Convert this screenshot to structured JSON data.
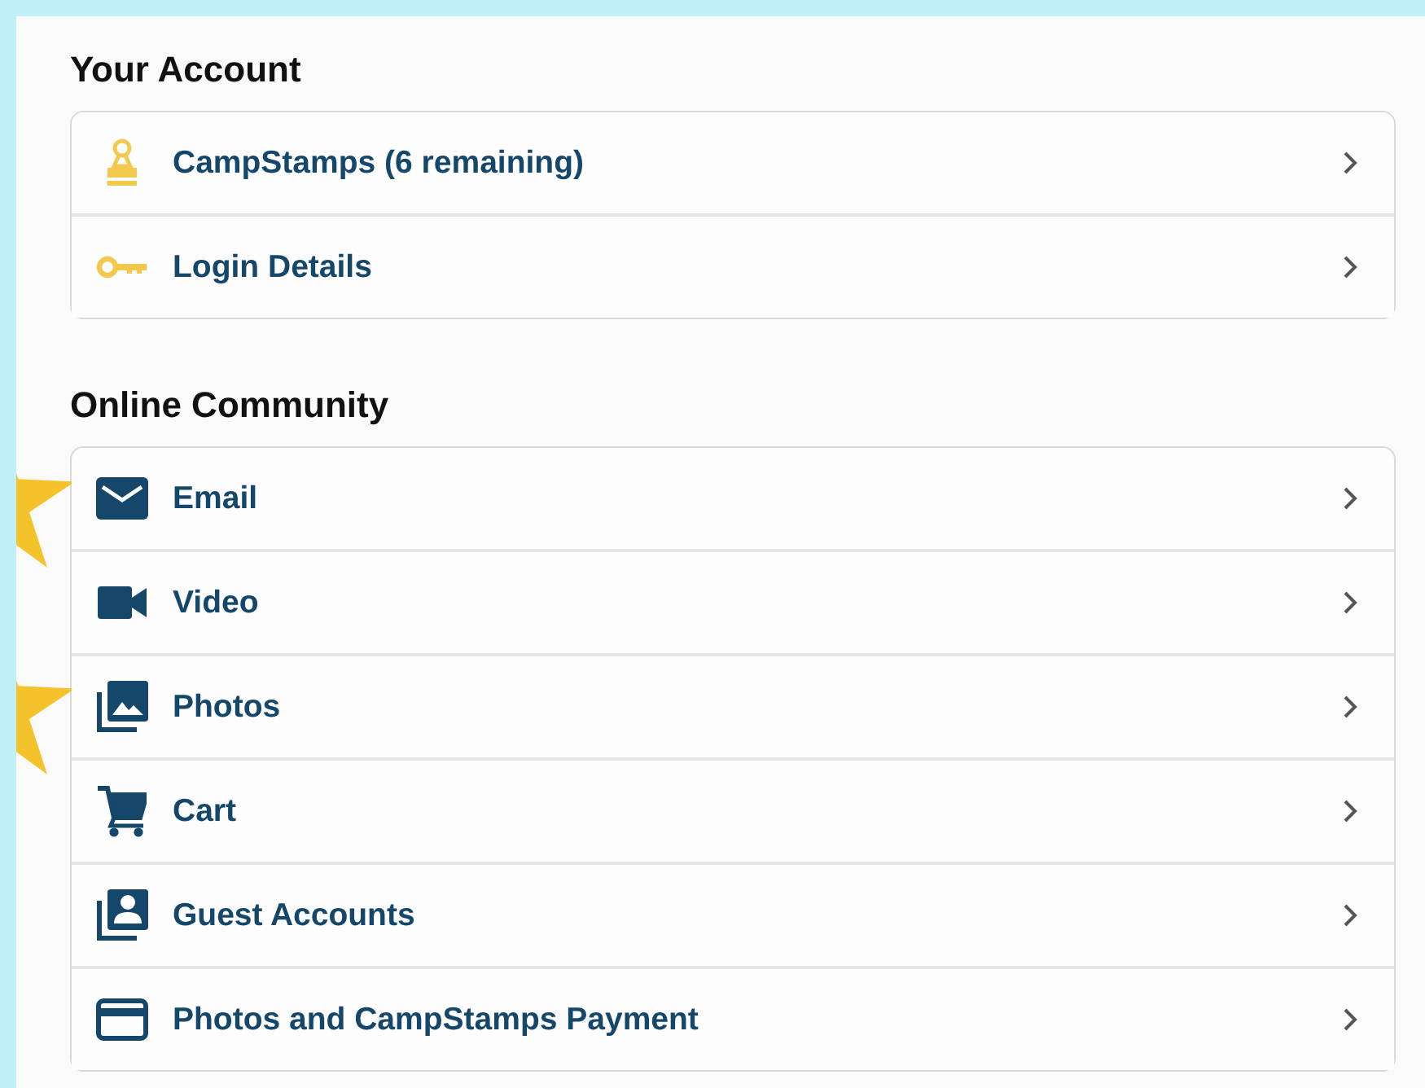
{
  "sections": [
    {
      "title": "Your Account",
      "items": [
        {
          "label": "CampStamps (6 remaining)",
          "starred": false
        },
        {
          "label": "Login Details",
          "starred": false
        }
      ]
    },
    {
      "title": "Online Community",
      "items": [
        {
          "label": "Email",
          "starred": true
        },
        {
          "label": "Video",
          "starred": false
        },
        {
          "label": "Photos",
          "starred": true
        },
        {
          "label": "Cart",
          "starred": false
        },
        {
          "label": "Guest Accounts",
          "starred": false
        },
        {
          "label": "Photos and CampStamps Payment",
          "starred": false
        }
      ]
    }
  ]
}
